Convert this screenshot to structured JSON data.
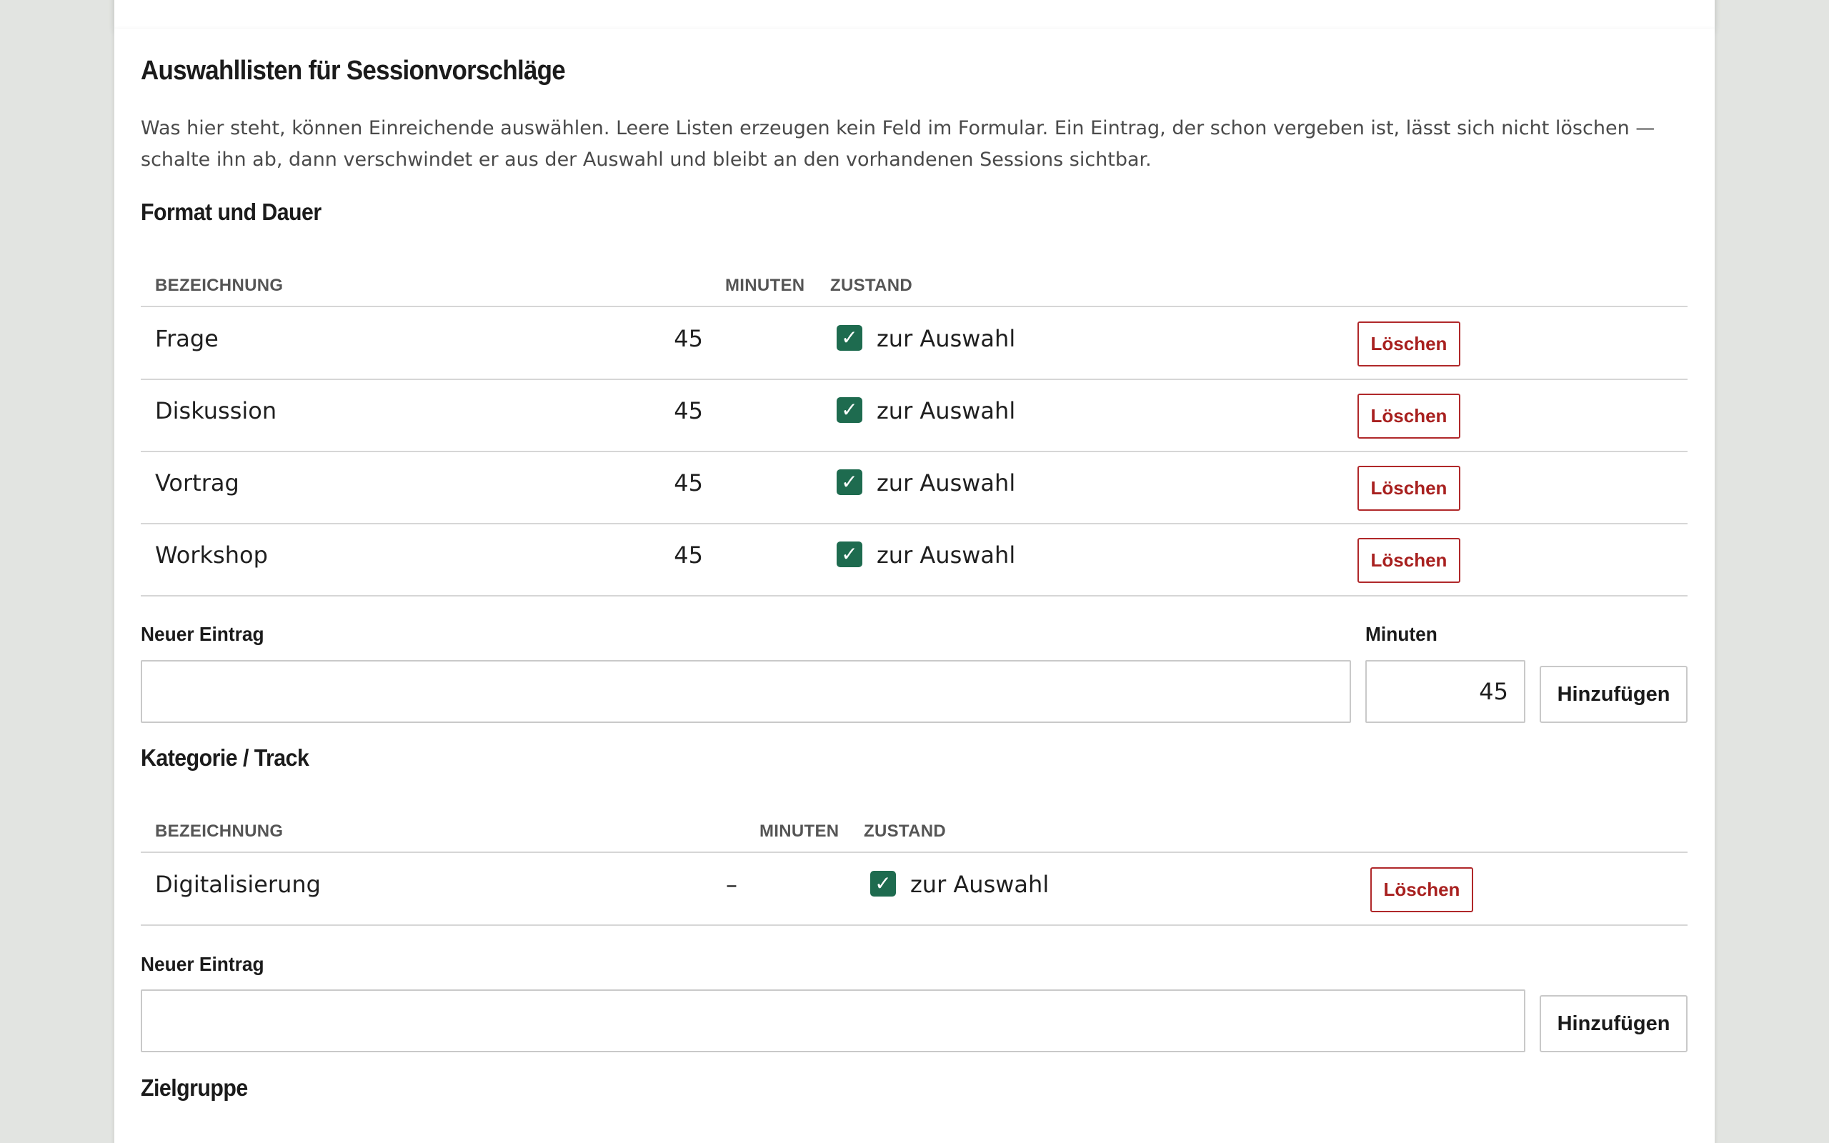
{
  "page": {
    "title": "Auswahllisten für Sessionvorschläge",
    "description": "Was hier steht, können Einreichende auswählen. Leere Listen erzeugen kein Feld im Formular. Ein Eintrag, der schon vergeben ist, lässt sich nicht löschen — schalte ihn ab, dann verschwindet er aus der Auswahl und bleibt an den vorhandenen Sessions sichtbar."
  },
  "format": {
    "heading": "Format und Dauer",
    "columns": {
      "name": "BEZEICHNUNG",
      "minutes": "MINUTEN",
      "state": "ZUSTAND"
    },
    "rows": [
      {
        "name": "Frage",
        "minutes": "45",
        "state_label": "zur Auswahl",
        "checked": true,
        "delete_label": "Löschen"
      },
      {
        "name": "Diskussion",
        "minutes": "45",
        "state_label": "zur Auswahl",
        "checked": true,
        "delete_label": "Löschen"
      },
      {
        "name": "Vortrag",
        "minutes": "45",
        "state_label": "zur Auswahl",
        "checked": true,
        "delete_label": "Löschen"
      },
      {
        "name": "Workshop",
        "minutes": "45",
        "state_label": "zur Auswahl",
        "checked": true,
        "delete_label": "Löschen"
      }
    ],
    "new_entry_label": "Neuer Eintrag",
    "new_entry_value": "",
    "minutes_label": "Minuten",
    "minutes_value": "45",
    "add_label": "Hinzufügen"
  },
  "category": {
    "heading": "Kategorie / Track",
    "columns": {
      "name": "BEZEICHNUNG",
      "minutes": "MINUTEN",
      "state": "ZUSTAND"
    },
    "rows": [
      {
        "name": "Digitalisierung",
        "minutes": "–",
        "state_label": "zur Auswahl",
        "checked": true,
        "delete_label": "Löschen"
      }
    ],
    "new_entry_label": "Neuer Eintrag",
    "new_entry_value": "",
    "add_label": "Hinzufügen"
  },
  "audience": {
    "heading": "Zielgruppe"
  },
  "colors": {
    "checkbox": "#1e6b4f",
    "delete": "#a8201f",
    "background": "#e2e4e1"
  },
  "icons": {
    "check": "checkmark-icon"
  }
}
